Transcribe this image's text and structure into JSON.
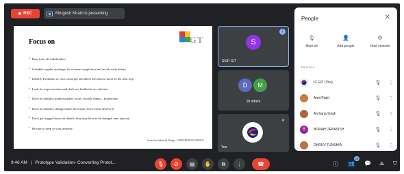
{
  "topbar": {
    "rec_label": "REC",
    "presenting_label": "Mrugesh Khatri is presenting"
  },
  "slide": {
    "title": "Focus on",
    "logo_text": "GT",
    "bullets": [
      "Hear from all stakeholders",
      "Schedule regular meetings, fix on time completion and avoid costly delays",
      "Identify Evolution of your prototype and allow the team to move to the next step",
      "Look for improvements and don't see feedbacks as criticism",
      "Don't be afraid to make mistakes or say 'foolish' things – brainstorm",
      "Don't be afraid to change earlier decisions if new ideas deserve it",
      "Don't get bogged down on details; they may have to be changed later anyway",
      "Be sure to keep to your timeline"
    ],
    "footer": "Centre for Industrial Design – GNDS DESIGN SCHOOL"
  },
  "tiles": {
    "speaker": {
      "initial": "S",
      "name": "SSIP GIT",
      "color": "#9334e6"
    },
    "others": {
      "initials": [
        "D",
        "M"
      ],
      "label": "18 others",
      "colors": [
        "#5c6bc0",
        "#43a047"
      ]
    },
    "self": {
      "name": "You"
    }
  },
  "panel": {
    "title": "People",
    "actions": [
      {
        "icon": "mic-off-icon",
        "label": "Mute all"
      },
      {
        "icon": "add-person-icon",
        "label": "Add people"
      },
      {
        "icon": "host-controls-icon",
        "label": "Host controls"
      }
    ],
    "section_label": "IN CALL",
    "people": [
      {
        "name": "IC GIT (You)",
        "initial": "",
        "color": "#ffffff"
      },
      {
        "name": "Amit Patel",
        "initial": "",
        "color": "#c77d3a"
      },
      {
        "name": "Archana Singh",
        "initial": "",
        "color": "#b0633b"
      },
      {
        "name": "BORAH DEBASISH",
        "initial": "B",
        "color": "#8e24aa"
      },
      {
        "name": "DHRUV TUNSHIA",
        "initial": "",
        "color": "#c27040"
      }
    ]
  },
  "bottombar": {
    "time": "9:46 AM",
    "separator": "|",
    "meeting_title": "Prototype Validation- Converting Protot...",
    "badge": "20"
  },
  "colors": {
    "accent": "#8ab4f8",
    "danger": "#ea4335",
    "background": "#202124"
  }
}
